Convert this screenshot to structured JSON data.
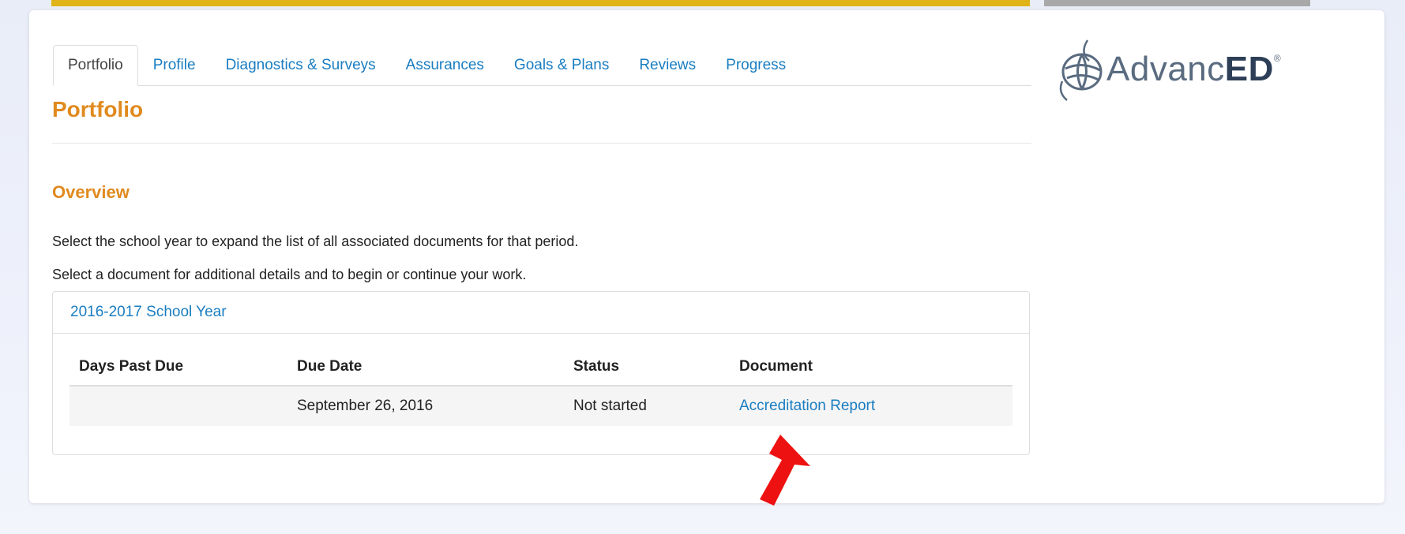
{
  "tabs": [
    {
      "label": "Portfolio",
      "active": true
    },
    {
      "label": "Profile",
      "active": false
    },
    {
      "label": "Diagnostics & Surveys",
      "active": false
    },
    {
      "label": "Assurances",
      "active": false
    },
    {
      "label": "Goals & Plans",
      "active": false
    },
    {
      "label": "Reviews",
      "active": false
    },
    {
      "label": "Progress",
      "active": false
    }
  ],
  "logo": {
    "text_a": "Advanc",
    "text_b": "ED",
    "mark": "®"
  },
  "page": {
    "title": "Portfolio",
    "section_title": "Overview",
    "instruction_1": "Select the school year to expand the list of all associated documents for that period.",
    "instruction_2": "Select a document for additional details and to begin or continue your work."
  },
  "school_year": {
    "label": "2016-2017 School Year",
    "columns": [
      "Days Past Due",
      "Due Date",
      "Status",
      "Document"
    ],
    "rows": [
      {
        "days_past_due": "",
        "due_date": "September 26, 2016",
        "status": "Not started",
        "document": "Accreditation Report"
      }
    ]
  },
  "colors": {
    "accent_orange": "#e08a1e",
    "link_blue": "#1a7dc1",
    "top_bar_yellow": "#e0b318",
    "arrow_red": "#ee1111"
  },
  "icons": {
    "logo_globe": "globe-icon",
    "pointer": "red-arrow-icon"
  }
}
